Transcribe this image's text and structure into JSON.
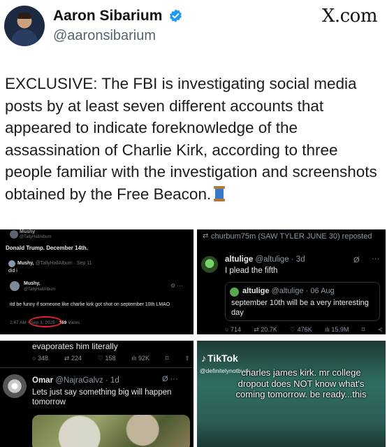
{
  "author": {
    "name": "Aaron Sibarium",
    "handle": "@aaronsibarium",
    "verified": true
  },
  "brand": "X.com",
  "tweet": {
    "text": "EXCLUSIVE: The FBI is investigating social media posts by at least seven different accounts that appeared to indicate foreknowledge of the assassination of Charlie Kirk, according to three people familiar with the investigation and screenshots obtained by the Free Beacon.",
    "emoji_icon": "spool-of-thread-icon"
  },
  "collage": {
    "top_left": {
      "top_name": "Mushy",
      "top_handle": "@TallyHallAlbum",
      "line1": "Donald Trump. December 14th.",
      "row2_name": "Mushy,",
      "row2_handle": "@TallyHallAlbum · Sep 11",
      "row2_text": "did i",
      "row3_name": "Mushy,",
      "row3_handle": "@TallyHallAlbum",
      "body": "itd be funny if someone like charlie kirk got shot on september 10th LMAO",
      "meta_time": "2:47 AM · Sep 3, 2025 ·",
      "meta_views_count": "169",
      "meta_views_label": "Views"
    },
    "top_right": {
      "repost_line": "churbum75m (SAW TYLER JUNE 30) reposted",
      "name": "altulige",
      "handle": "@altulige · 3d",
      "text": "I plead the fifth",
      "quote_name": "altulige",
      "quote_handle": "@altulige · 06 Aug",
      "quote_text": "september 10th will be a very interesting day",
      "metrics": [
        "714",
        "20.7K",
        "476K",
        "15.9M"
      ]
    },
    "bottom_left": {
      "top_text": "evaporates him literally",
      "metrics": [
        "348",
        "224",
        "158",
        "92K"
      ],
      "name": "Omar",
      "handle": "@NajraGalvz · 1d",
      "text": "Lets just say something big will happen tomorrow"
    },
    "bottom_right": {
      "logo": "TikTok",
      "handle": "@definitelynotbusk",
      "caption": "charles james kirk. mr college dropout does NOT know what's coming tomorrow. be ready...this"
    }
  },
  "colors": {
    "verified_badge": "#1d9bf0",
    "panel_bg": "#000000",
    "highlight_circle": "#e0242b"
  }
}
